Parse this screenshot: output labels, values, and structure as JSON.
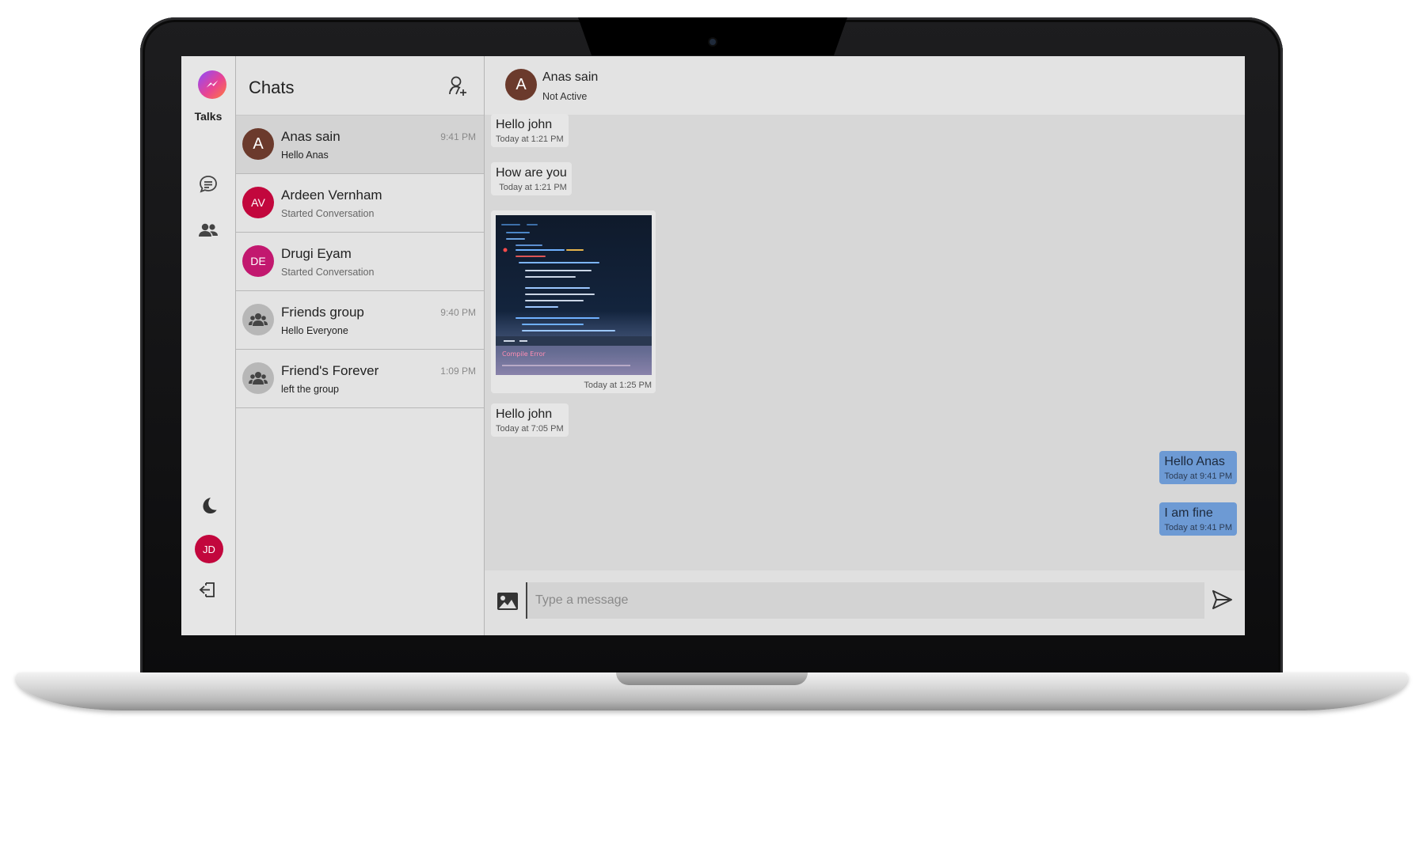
{
  "app": {
    "brand": "Talks",
    "rail_icons": [
      "messenger-logo-icon",
      "chats-icon",
      "people-icon",
      "moon-icon",
      "logout-icon"
    ],
    "current_user_initials": "JD",
    "current_user_color": "#c2073d"
  },
  "chat_list": {
    "title": "Chats",
    "items": [
      {
        "name": "Anas sain",
        "preview": "Hello Anas",
        "time": "9:41 PM",
        "initials": "A",
        "avatar_color": "#6b3a2c",
        "active": true,
        "group": false
      },
      {
        "name": "Ardeen Vernham",
        "preview": "Started Conversation",
        "time": "",
        "initials": "AV",
        "avatar_color": "#c2073d",
        "active": false,
        "group": false
      },
      {
        "name": "Drugi Eyam",
        "preview": "Started Conversation",
        "time": "",
        "initials": "DE",
        "avatar_color": "#c2186f",
        "active": false,
        "group": false
      },
      {
        "name": "Friends group",
        "preview": "Hello Everyone",
        "time": "9:40 PM",
        "initials": "",
        "avatar_color": "#b7b7b7",
        "active": false,
        "group": true
      },
      {
        "name": "Friend's Forever",
        "preview": "left the group",
        "time": "1:09 PM",
        "initials": "",
        "avatar_color": "#b7b7b7",
        "active": false,
        "group": true
      }
    ]
  },
  "conversation": {
    "contact_name": "Anas sain",
    "contact_initial": "A",
    "contact_status": "Not Active",
    "messages": [
      {
        "text": "Hello john",
        "time": "Today at 1:21 PM",
        "direction": "in"
      },
      {
        "text": "How are you",
        "time": "Today at 1:21 PM",
        "direction": "in"
      },
      {
        "image": "code-screenshot",
        "time": "Today at 1:25 PM",
        "direction": "in"
      },
      {
        "text": "Hello john",
        "time": "Today at 7:05 PM",
        "direction": "in"
      },
      {
        "text": "Hello Anas",
        "time": "Today at 9:41 PM",
        "direction": "out"
      },
      {
        "text": "I am fine",
        "time": "Today at 9:41 PM",
        "direction": "out"
      }
    ],
    "image_caption_text": "Compile Error"
  },
  "composer": {
    "placeholder": "Type a message",
    "value": ""
  },
  "colors": {
    "outgoing_bubble": "#6d9ad4",
    "incoming_bubble": "#e6e6e6",
    "accent_red": "#c2073d"
  }
}
